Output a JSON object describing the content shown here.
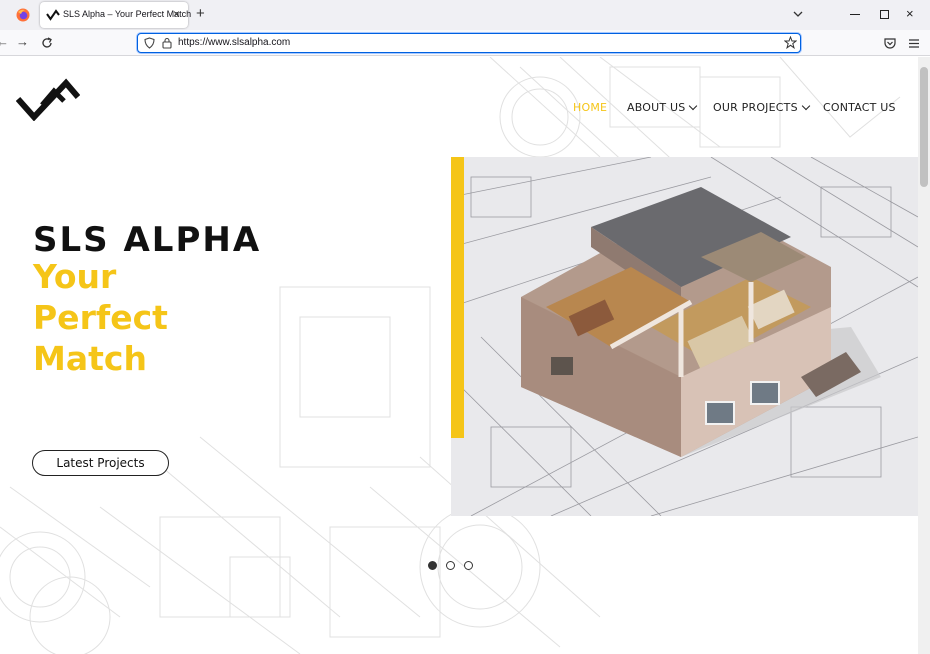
{
  "browser": {
    "tab_title": "SLS Alpha – Your Perfect Match",
    "url": "https://www.slsalpha.com",
    "new_tab_symbol": "+",
    "close_symbol": "×"
  },
  "site": {
    "nav": {
      "home": "HOME",
      "about": "ABOUT US",
      "projects": "OUR PROJECTS",
      "contact": "CONTACT US"
    },
    "hero": {
      "title": "SLS ALPHA",
      "subtitle_line1": "Your",
      "subtitle_line2": "Perfect",
      "subtitle_line3": "Match",
      "cta": "Latest Projects"
    },
    "carousel": {
      "slides": 3,
      "active": 1
    }
  },
  "colors": {
    "accent": "#f5c518",
    "text": "#111111",
    "url_focus": "#0061e0"
  },
  "icons": [
    "firefox-icon",
    "sls-favicon",
    "close-icon",
    "plus-icon",
    "chevron-down-icon",
    "minimize-icon",
    "maximize-icon",
    "back-icon",
    "forward-icon",
    "reload-icon",
    "shield-icon",
    "lock-icon",
    "star-icon",
    "pocket-icon",
    "menu-icon",
    "sls-logo"
  ]
}
